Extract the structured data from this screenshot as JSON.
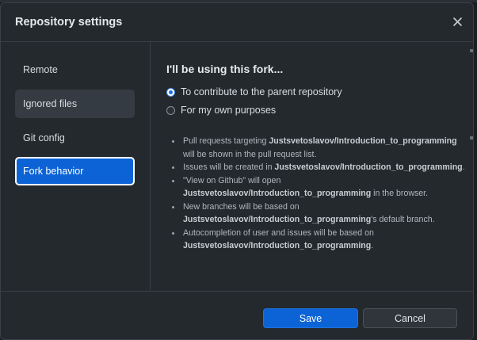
{
  "dialog": {
    "title": "Repository settings",
    "close_icon": "close-icon"
  },
  "sidebar": {
    "items": [
      {
        "label": "Remote",
        "state": "normal"
      },
      {
        "label": "Ignored files",
        "state": "hover"
      },
      {
        "label": "Git config",
        "state": "normal"
      },
      {
        "label": "Fork behavior",
        "state": "selected"
      }
    ]
  },
  "content": {
    "heading": "I'll be using this fork...",
    "options": [
      {
        "label": "To contribute to the parent repository",
        "checked": true
      },
      {
        "label": "For my own purposes",
        "checked": false
      }
    ],
    "repo": "Justsvetoslavov/Introduction_to_programming",
    "bullets": [
      {
        "before": "Pull requests targeting ",
        "after": " will be shown in the pull request list."
      },
      {
        "before": "Issues will be created in ",
        "after": "."
      },
      {
        "before": "\"View on Github\" will open ",
        "after": " in the browser."
      },
      {
        "before": "New branches will be based on ",
        "after": "'s default branch."
      },
      {
        "before": "Autocompletion of user and issues will be based on ",
        "after": "."
      }
    ]
  },
  "footer": {
    "save_label": "Save",
    "cancel_label": "Cancel"
  },
  "colors": {
    "accent": "#0b63d6",
    "dialog_bg": "#24292e",
    "border": "#383e45"
  }
}
